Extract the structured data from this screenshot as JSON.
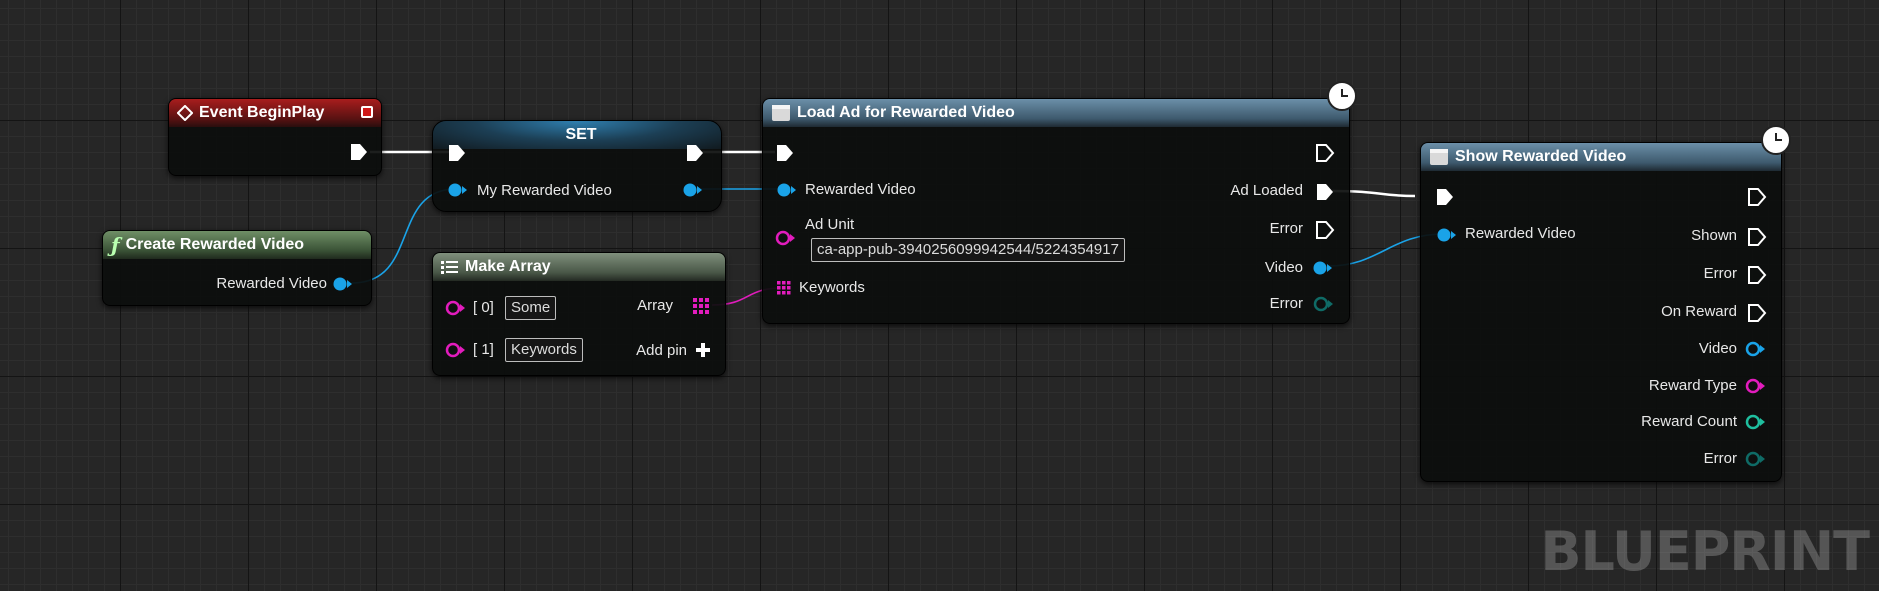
{
  "nodes": {
    "event_begin_play": {
      "title": "Event BeginPlay"
    },
    "set": {
      "title": "SET",
      "pin_label": "My Rewarded Video"
    },
    "create_rewarded_video": {
      "title": "Create Rewarded Video",
      "out_label": "Rewarded Video"
    },
    "make_array": {
      "title": "Make Array",
      "items": [
        {
          "index": "[ 0]",
          "value": "Some"
        },
        {
          "index": "[ 1]",
          "value": "Keywords"
        }
      ],
      "array_label": "Array",
      "add_pin_label": "Add pin"
    },
    "load_ad": {
      "title": "Load Ad for Rewarded Video",
      "in_rewarded_video": "Rewarded Video",
      "ad_unit_label": "Ad Unit",
      "ad_unit_value": "ca-app-pub-3940256099942544/5224354917",
      "keywords_label": "Keywords",
      "ad_loaded": "Ad Loaded",
      "error_exec": "Error",
      "video": "Video",
      "error_struct": "Error"
    },
    "show_rewarded": {
      "title": "Show Rewarded Video",
      "in_rewarded_video": "Rewarded Video",
      "shown": "Shown",
      "error_exec": "Error",
      "on_reward": "On Reward",
      "video": "Video",
      "reward_type": "Reward Type",
      "reward_count": "Reward Count",
      "error_struct": "Error"
    }
  },
  "watermark": "BLUEPRINT",
  "colors": {
    "object_pin": "#1aa3e8",
    "string_pin": "#e21cbd",
    "struct_pin": "#0f6b66",
    "int_pin": "#1fbf9f",
    "exec_pin": "#ffffff",
    "event_header": "#a81d1d"
  }
}
